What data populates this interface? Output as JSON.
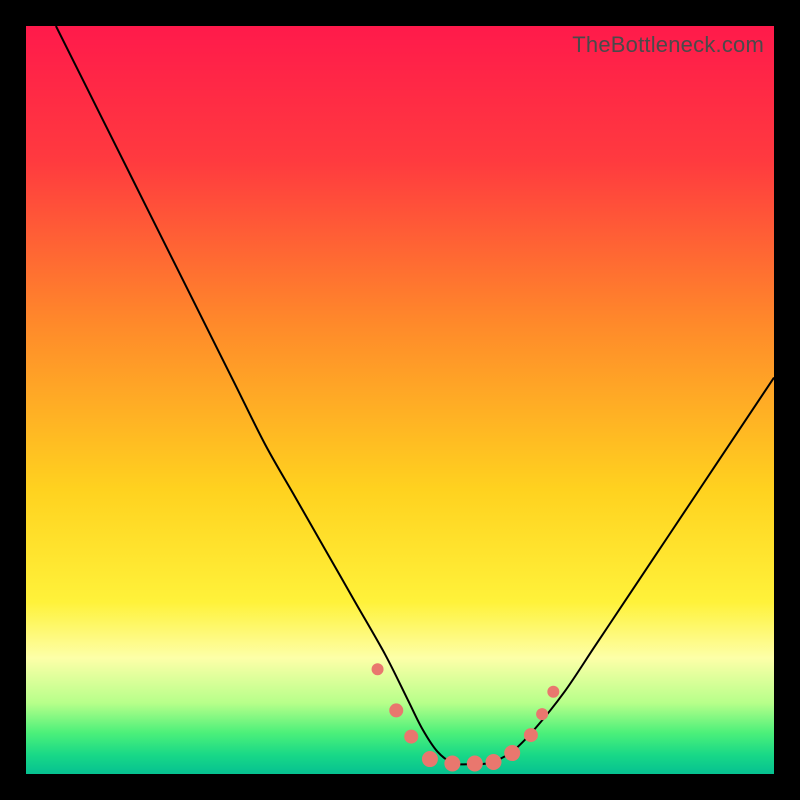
{
  "watermark": "TheBottleneck.com",
  "chart_data": {
    "type": "line",
    "title": "",
    "xlabel": "",
    "ylabel": "",
    "xlim": [
      0,
      100
    ],
    "ylim": [
      0,
      100
    ],
    "gradient_stops": [
      {
        "offset": 0.0,
        "color": "#ff1a4b"
      },
      {
        "offset": 0.18,
        "color": "#ff3a3f"
      },
      {
        "offset": 0.4,
        "color": "#ff8a2a"
      },
      {
        "offset": 0.62,
        "color": "#ffd21f"
      },
      {
        "offset": 0.77,
        "color": "#fff23a"
      },
      {
        "offset": 0.845,
        "color": "#fdffa8"
      },
      {
        "offset": 0.905,
        "color": "#b7ff8a"
      },
      {
        "offset": 0.945,
        "color": "#4cf07a"
      },
      {
        "offset": 0.975,
        "color": "#18d887"
      },
      {
        "offset": 1.0,
        "color": "#06c191"
      }
    ],
    "series": [
      {
        "name": "bottleneck-curve",
        "x": [
          4,
          8,
          12,
          16,
          20,
          24,
          28,
          32,
          36,
          40,
          44,
          48,
          51,
          53,
          55,
          57,
          59,
          62,
          65,
          68,
          72,
          76,
          80,
          84,
          88,
          92,
          96,
          100
        ],
        "y": [
          100,
          92,
          84,
          76,
          68,
          60,
          52,
          44,
          37,
          30,
          23,
          16,
          10,
          6,
          3,
          1.5,
          1.3,
          1.5,
          3,
          6,
          11,
          17,
          23,
          29,
          35,
          41,
          47,
          53
        ]
      }
    ],
    "markers": {
      "name": "highlighted-points",
      "color": "#e9776e",
      "points": [
        {
          "x": 47.0,
          "y": 14.0,
          "r": 6
        },
        {
          "x": 49.5,
          "y": 8.5,
          "r": 7
        },
        {
          "x": 51.5,
          "y": 5.0,
          "r": 7
        },
        {
          "x": 54.0,
          "y": 2.0,
          "r": 8
        },
        {
          "x": 57.0,
          "y": 1.4,
          "r": 8
        },
        {
          "x": 60.0,
          "y": 1.4,
          "r": 8
        },
        {
          "x": 62.5,
          "y": 1.6,
          "r": 8
        },
        {
          "x": 65.0,
          "y": 2.8,
          "r": 8
        },
        {
          "x": 67.5,
          "y": 5.2,
          "r": 7
        },
        {
          "x": 69.0,
          "y": 8.0,
          "r": 6
        },
        {
          "x": 70.5,
          "y": 11.0,
          "r": 6
        }
      ]
    }
  }
}
